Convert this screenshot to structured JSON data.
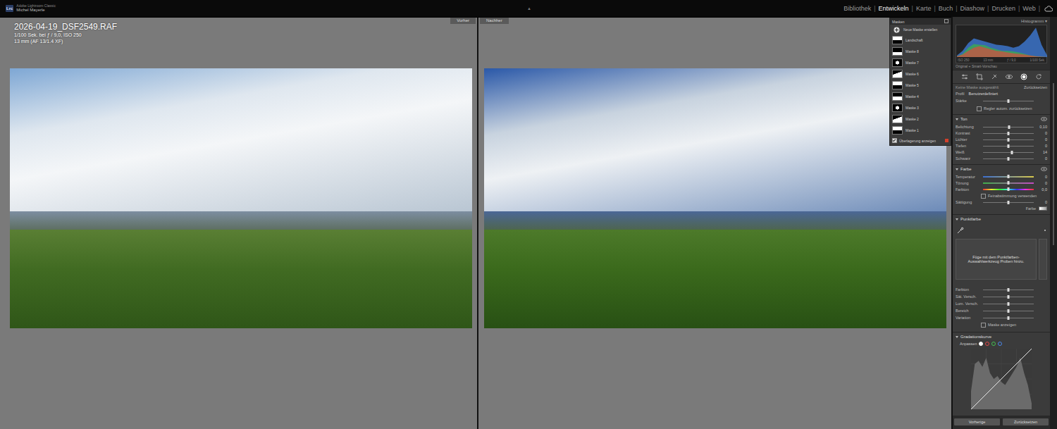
{
  "app": {
    "logo": "Lrc",
    "product": "Adobe Lightroom Classic",
    "user": "Michel Mayerle",
    "collapse_glyph": "▲"
  },
  "modules": [
    {
      "label": "Bibliothek",
      "selected": false
    },
    {
      "label": "Entwickeln",
      "selected": true
    },
    {
      "label": "Karte",
      "selected": false
    },
    {
      "label": "Buch",
      "selected": false
    },
    {
      "label": "Diashow",
      "selected": false
    },
    {
      "label": "Drucken",
      "selected": false
    },
    {
      "label": "Web",
      "selected": false
    }
  ],
  "module_separator": "|",
  "photo_info": {
    "filename": "2026-04-19_DSF2549.RAF",
    "exposure": "1/100 Sek. bei ƒ / 9,0, ISO 250",
    "lens": "13 mm (AF 13/1.4 XF)"
  },
  "views": [
    {
      "label": "Vorher",
      "edited": false
    },
    {
      "label": "Nachher",
      "edited": true
    }
  ],
  "masks": {
    "title": "Masken",
    "create": "Neue Maske erstellen",
    "items": [
      {
        "label": "Landschaft",
        "selected": false
      },
      {
        "label": "Maske 8",
        "selected": false
      },
      {
        "label": "Maske 7",
        "selected": false
      },
      {
        "label": "Maske 6",
        "selected": false
      },
      {
        "label": "Maske 5",
        "selected": false
      },
      {
        "label": "Maske 4",
        "selected": false
      },
      {
        "label": "Maske 3",
        "selected": false
      },
      {
        "label": "Maske 2",
        "selected": false
      },
      {
        "label": "Maske 1",
        "selected": false
      }
    ],
    "overlay": {
      "label": "Überlagerung anzeigen",
      "checked": true
    }
  },
  "histogram": {
    "title": "Histogramm",
    "series": [
      {
        "channel": "blue",
        "color": "#3f7fe0",
        "values": [
          0.05,
          0.2,
          0.45,
          0.6,
          0.55,
          0.5,
          0.45,
          0.4,
          0.38,
          0.35,
          0.3,
          0.35,
          0.5,
          0.7,
          0.95,
          0.4,
          0.05
        ]
      },
      {
        "channel": "green",
        "color": "#3fae4a",
        "values": [
          0.02,
          0.1,
          0.3,
          0.42,
          0.4,
          0.38,
          0.3,
          0.25,
          0.2,
          0.2,
          0.18,
          0.15,
          0.1,
          0.05,
          0.03,
          0.01,
          0.0
        ]
      },
      {
        "channel": "red",
        "color": "#d0503f",
        "values": [
          0.02,
          0.08,
          0.2,
          0.3,
          0.35,
          0.3,
          0.25,
          0.2,
          0.18,
          0.15,
          0.12,
          0.1,
          0.08,
          0.05,
          0.02,
          0.01,
          0.0
        ]
      }
    ],
    "readouts": [
      "ISO 250",
      "13 mm",
      "ƒ / 9,0",
      "1/100 Sek."
    ],
    "status": "Original + Smart-Vorschau"
  },
  "tools": [
    {
      "kind": "edit",
      "selected": false
    },
    {
      "kind": "crop",
      "selected": false
    },
    {
      "kind": "heal",
      "selected": false
    },
    {
      "kind": "redeye",
      "selected": false
    },
    {
      "kind": "mask",
      "selected": true
    },
    {
      "kind": "reset",
      "selected": false
    }
  ],
  "mask_settings": {
    "title": "Keine Maske ausgewählt",
    "reset": "Zurücksetzen",
    "profile_label": "Profil",
    "profile_value": "Benutzerdefiniert",
    "amount": {
      "label": "Stärke",
      "level": 0.5
    },
    "auto_reset": {
      "label": "Regler autom. zurücksetzen",
      "checked": false
    }
  },
  "tone": {
    "title": "Ton",
    "expanded": true,
    "rows": [
      {
        "kind": "slider",
        "label": "Belichtung",
        "level": 0.52,
        "value": "0,10"
      },
      {
        "kind": "slider",
        "label": "Kontrast",
        "level": 0.5,
        "value": "0"
      },
      {
        "kind": "slider",
        "label": "Lichter",
        "level": 0.5,
        "value": "0"
      },
      {
        "kind": "slider",
        "label": "Tiefen",
        "level": 0.5,
        "value": "0"
      },
      {
        "kind": "slider",
        "label": "Weiß",
        "level": 0.57,
        "value": "14"
      },
      {
        "kind": "slider",
        "label": "Schwarz",
        "level": 0.5,
        "value": "0"
      }
    ]
  },
  "color": {
    "title": "Farbe",
    "expanded": true,
    "rows": [
      {
        "kind": "temp",
        "label": "Temperatur",
        "level": 0.5,
        "value": "0"
      },
      {
        "kind": "tint",
        "label": "Tönung",
        "level": 0.5,
        "value": "0"
      },
      {
        "kind": "hue",
        "label": "Farbton",
        "level": 0.5,
        "value": "0,0"
      },
      {
        "kind": "check",
        "label": "Feinabstimmung verwenden",
        "checked": false
      },
      {
        "kind": "slider",
        "label": "Sättigung",
        "level": 0.5,
        "value": "0"
      },
      {
        "kind": "swatch",
        "label": "Farbe"
      }
    ]
  },
  "point_color": {
    "title": "Punktfarbe",
    "expanded": true,
    "hint": "Füge mit dem Punktfarben-Auswahlwerkzeug Proben hinzu.",
    "rows": [
      {
        "kind": "slider",
        "label": "Farbton",
        "level": 0.5
      },
      {
        "kind": "slider",
        "label": "Sät. Versch.",
        "level": 0.5
      },
      {
        "kind": "slider",
        "label": "Lum. Versch.",
        "level": 0.5
      },
      {
        "kind": "slider",
        "label": "Bereich",
        "level": 0.5
      },
      {
        "kind": "slider",
        "label": "Variation",
        "level": 0.5
      },
      {
        "kind": "check",
        "label": "Maske anzeigen",
        "checked": false
      }
    ]
  },
  "curve": {
    "title": "Gradationskurve",
    "expanded": true,
    "adjust_label": "Anpassen",
    "channels": [
      {
        "color": "#ffffff",
        "selected": true
      },
      {
        "color": "#e04848",
        "selected": false
      },
      {
        "color": "#44c050",
        "selected": false
      },
      {
        "color": "#4a86e8",
        "selected": false
      }
    ],
    "histogram": [
      0.3,
      0.75,
      0.8,
      0.7,
      0.85,
      0.6,
      0.5,
      0.55,
      0.45,
      0.4,
      0.5,
      0.6,
      0.7,
      0.85,
      0.6,
      0.4,
      0.1
    ],
    "points": [
      [
        0,
        0
      ],
      [
        1,
        1
      ]
    ]
  },
  "footer": {
    "buttons": [
      "Vorherige",
      "Zurücksetzen"
    ]
  }
}
